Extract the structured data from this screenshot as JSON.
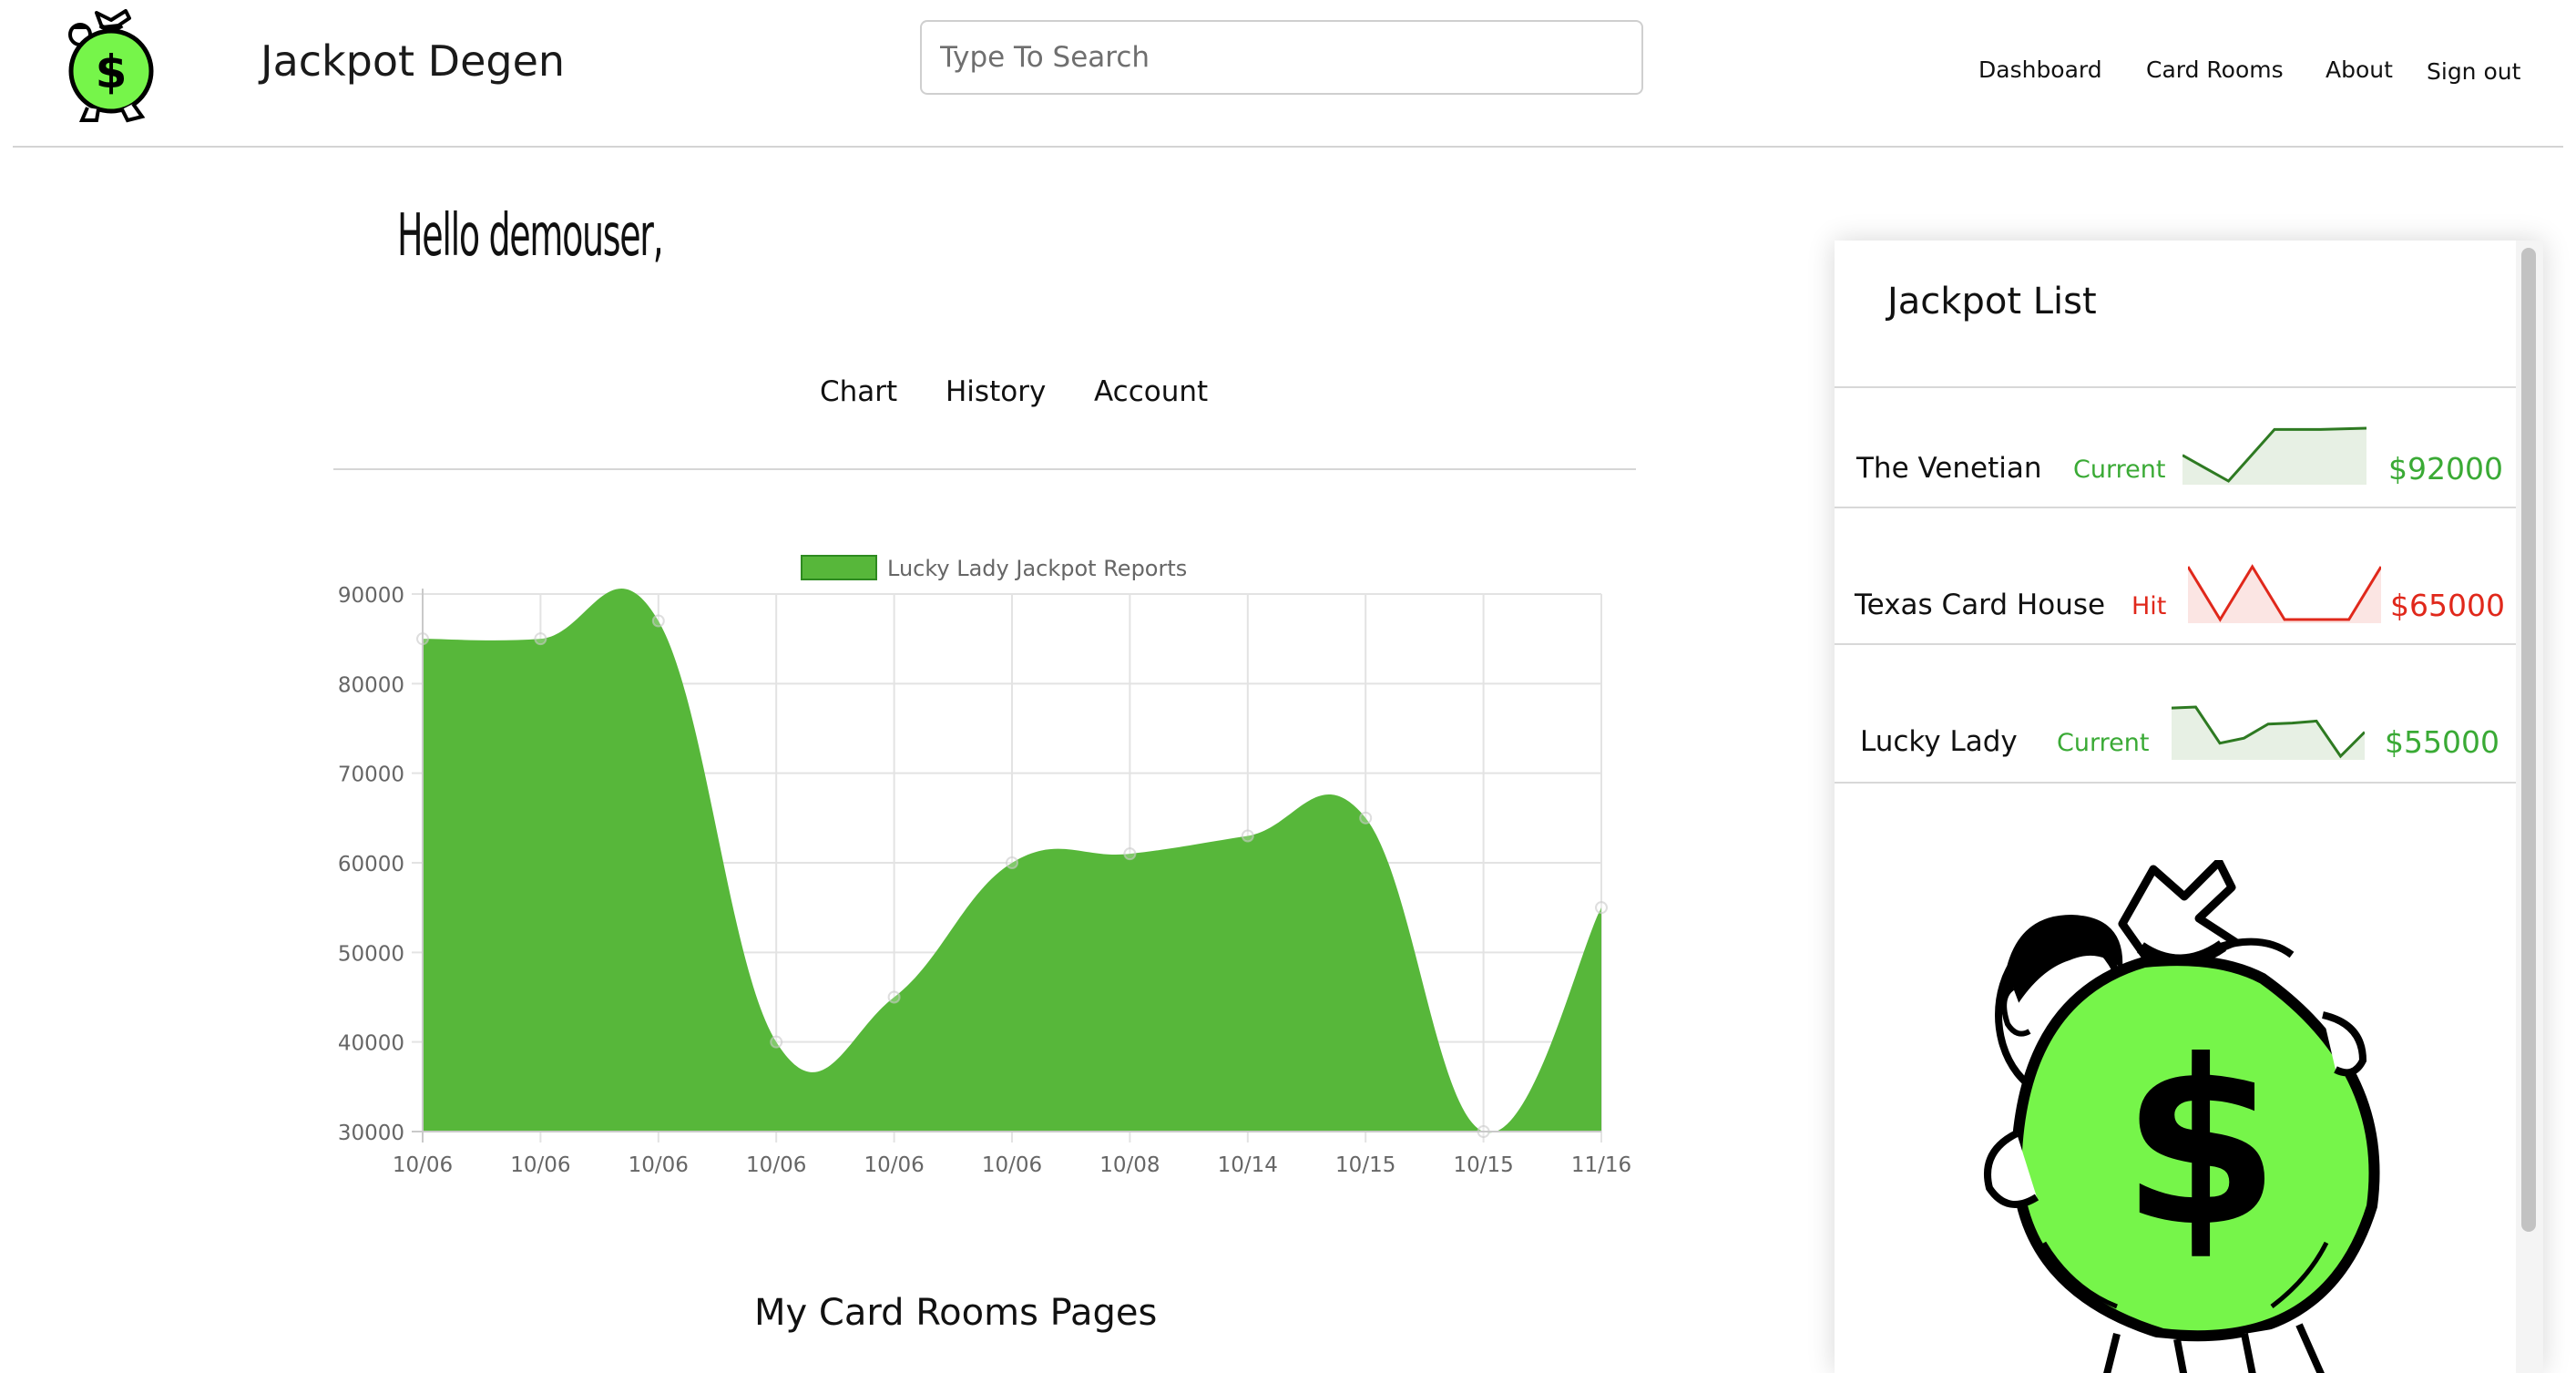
{
  "header": {
    "brand": "Jackpot Degen",
    "search_placeholder": "Type To Search",
    "logo_icon": "moneybag-man-icon",
    "nav": [
      {
        "label": "Dashboard"
      },
      {
        "label": "Card Rooms"
      },
      {
        "label": "About"
      },
      {
        "label": "Sign out"
      }
    ]
  },
  "main": {
    "greeting": "Hello demouser,",
    "tabs": [
      {
        "label": "Chart"
      },
      {
        "label": "History"
      },
      {
        "label": "Account"
      }
    ],
    "section_title": "My Card Rooms Pages"
  },
  "chart_data": {
    "type": "area",
    "title": "",
    "legend": [
      {
        "label": "Lucky Lady Jackpot Reports",
        "color": "#57b73a"
      }
    ],
    "legend_position": "top-center",
    "categories": [
      "10/06",
      "10/06",
      "10/06",
      "10/06",
      "10/06",
      "10/06",
      "10/08",
      "10/14",
      "10/15",
      "10/15",
      "11/16"
    ],
    "series": [
      {
        "name": "Lucky Lady Jackpot Reports",
        "values": [
          85000,
          85000,
          87000,
          40000,
          45000,
          60000,
          61000,
          63000,
          65000,
          30000,
          55000
        ],
        "color": "#57b73a"
      }
    ],
    "ylim": [
      30000,
      90000
    ],
    "yticks": [
      "90000",
      "80000",
      "70000",
      "60000",
      "50000",
      "40000",
      "30000"
    ],
    "grid": true,
    "xlabel": "",
    "ylabel": ""
  },
  "panel": {
    "title": "Jackpot List",
    "rooms": [
      {
        "name": "The Venetian",
        "status": "Current",
        "amount": "$92000",
        "trend": [
          3,
          1,
          5,
          5,
          5.1
        ],
        "color": "#3aaa35",
        "line": "#2e7a22",
        "fill": "#e7f0e4"
      },
      {
        "name": "Texas Card House",
        "status": "Hit",
        "amount": "$65000",
        "trend": [
          5,
          1,
          5,
          1,
          1,
          1,
          5
        ],
        "color": "#e0281b",
        "line": "#e0281b",
        "fill": "#fbe5e3"
      },
      {
        "name": "Lucky Lady",
        "status": "Current",
        "amount": "$55000",
        "trend": [
          5,
          5.1,
          1.5,
          2,
          3.4,
          3.5,
          3.7,
          0.2,
          2.6
        ],
        "color": "#3aaa35",
        "line": "#2e7a22",
        "fill": "#e7f0e4"
      }
    ],
    "illustration_icon": "moneybag-man-icon"
  },
  "colors": {
    "accent_green": "#57b73a",
    "current_green": "#3aaa35",
    "hit_red": "#e0281b",
    "bag_green": "#76f54a"
  }
}
